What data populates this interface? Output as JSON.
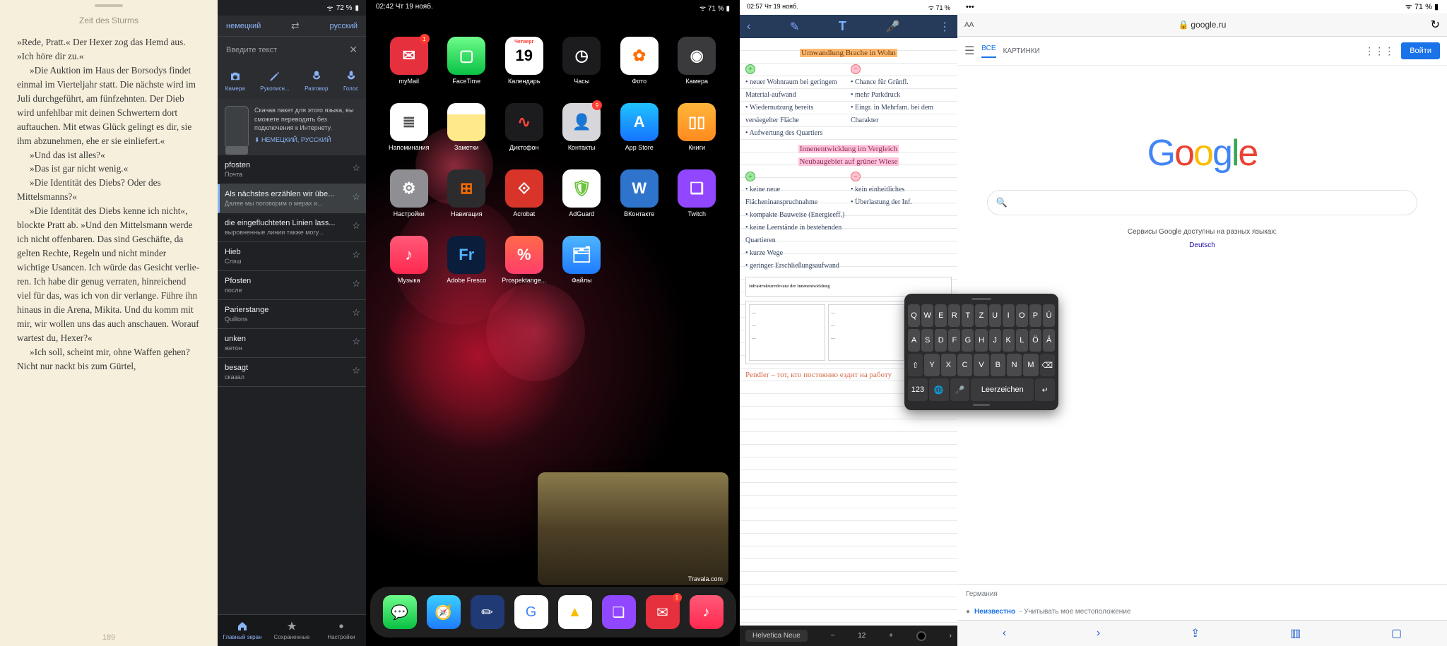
{
  "ereader": {
    "title": "Zeit des Sturms",
    "page": "189",
    "paragraphs": [
      "»Rede, Pratt.« Der Hexer zog das Hemd aus. »Ich höre dir zu.«",
      "»Die Auktion im Haus der Borsodys findet einmal im Vierteljahr statt. Die nächste wird im Juli durchgeführt, am fünfzehnten. Der Dieb wird unfehlbar mit deinen Schwertern dort auftau­chen. Mit etwas Glück gelingt es dir, sie ihm abzunehmen, ehe er sie einlie­fert.«",
      "»Und das ist alles?«",
      "»Das ist gar nicht wenig.«",
      "»Die Identität des Diebs? Oder des Mittelsmanns?«",
      "»Die Identität des Diebs kenne ich nicht«, blockte Pratt ab. »Und den Mit­telsmann werde ich nicht offenbaren. Das sind Geschäfte, da gelten Rechte, Regeln und nicht minder wichtige Usancen. Ich würde das Gesicht verlie­ren. Ich habe dir genug verraten, hin­reichend viel für das, was ich von dir verlange. Führe ihn hinaus in die Are­na, Mikita. Und du komm mit mir, wir wollen uns das auch anschauen. Wor­auf wartest du, Hexer?«",
      "»Ich soll, scheint mir, ohne Waffen gehen? Nicht nur nackt bis zum Gürtel,"
    ]
  },
  "translator": {
    "status_right": "72 %",
    "lang_from": "немецкий",
    "lang_to": "русский",
    "placeholder": "Введите текст",
    "modes": [
      {
        "icon": "camera",
        "label": "Камера"
      },
      {
        "icon": "pen",
        "label": "Рукописн..."
      },
      {
        "icon": "mic2",
        "label": "Разговор"
      },
      {
        "icon": "mic",
        "label": "Голос"
      }
    ],
    "offline_text": "Скачав пакет для этого языка, вы сможете переводить без подключения к Интернету.",
    "offline_langs": "⬇ НЕМЕЦКИЙ, РУССКИЙ",
    "rows": [
      {
        "t": "pfosten",
        "s": "Почта"
      },
      {
        "t": "Als nächstes erzählen wir übe...",
        "s": "Далее мы поговорим о мерах и...",
        "sel": true
      },
      {
        "t": "die eingefluchteten Linien lass...",
        "s": "выровненные линии также могу..."
      },
      {
        "t": "Hieb",
        "s": "Слэш"
      },
      {
        "t": "Pfosten",
        "s": "после"
      },
      {
        "t": "Parierstange",
        "s": "Quillons"
      },
      {
        "t": "unken",
        "s": "жетон"
      },
      {
        "t": "besagt",
        "s": "сказал"
      }
    ],
    "tabs": [
      {
        "label": "Главный экран",
        "icon": "home",
        "active": true
      },
      {
        "label": "Сохраненные",
        "icon": "star"
      },
      {
        "label": "Настройки",
        "icon": "gear"
      }
    ]
  },
  "home": {
    "status_left": "02:42  Чт 19 нояб.",
    "status_right": "71 %",
    "apps": [
      {
        "label": "myMail",
        "bg": "#e6303d",
        "glyph": "✉",
        "badge": "1"
      },
      {
        "label": "FaceTime",
        "bg": "linear-gradient(#6efc8a,#09c143)",
        "glyph": "▢"
      },
      {
        "label": "Календарь",
        "bg": "#fff",
        "glyph": "19",
        "fg": "#000",
        "top": "Четверг"
      },
      {
        "label": "Часы",
        "bg": "#1c1c1e",
        "glyph": "◷"
      },
      {
        "label": "Фото",
        "bg": "#fff",
        "glyph": "✿",
        "fg": "#ff6d00"
      },
      {
        "label": "Камера",
        "bg": "#3a3a3c",
        "glyph": "◉"
      },
      {
        "label": "Напоминания",
        "bg": "#fff",
        "glyph": "≣",
        "fg": "#555"
      },
      {
        "label": "Заметки",
        "bg": "linear-gradient(#fff 30%,#ffe98a 30%)",
        "glyph": "",
        "fg": "#000"
      },
      {
        "label": "Диктофон",
        "bg": "#1c1c1e",
        "glyph": "∿",
        "fg": "#ff453a"
      },
      {
        "label": "Контакты",
        "bg": "#d7d7db",
        "glyph": "👤",
        "badge": "9"
      },
      {
        "label": "App Store",
        "bg": "linear-gradient(#1fc3ff,#1673ff)",
        "glyph": "A"
      },
      {
        "label": "Книги",
        "bg": "linear-gradient(#ffb63a,#ff8a1f)",
        "glyph": "▯▯"
      },
      {
        "label": "Настройки",
        "bg": "#8e8e93",
        "glyph": "⚙"
      },
      {
        "label": "Навигация",
        "bg": "#2c2c2e",
        "glyph": "⊞",
        "fg": "#ff6d00"
      },
      {
        "label": "Acrobat",
        "bg": "#d8342a",
        "glyph": "⟐"
      },
      {
        "label": "AdGuard",
        "bg": "#fff",
        "glyph": "🛡",
        "fg": "#6bc23c"
      },
      {
        "label": "ВКонтакте",
        "bg": "#2e74cc",
        "glyph": "W"
      },
      {
        "label": "Twitch",
        "bg": "#9146ff",
        "glyph": "❏"
      },
      {
        "label": "Музыка",
        "bg": "linear-gradient(#ff5a78,#ff2850)",
        "glyph": "♪"
      },
      {
        "label": "Adobe Fresco",
        "bg": "#0a1d3a",
        "glyph": "Fr",
        "fg": "#4fb3ff"
      },
      {
        "label": "Prospektange...",
        "bg": "linear-gradient(#ff6a4a,#ff3e6a)",
        "glyph": "%"
      },
      {
        "label": "Файлы",
        "bg": "linear-gradient(#4fb6ff,#1f7bff)",
        "glyph": "🗂"
      }
    ],
    "pip_brand": "Travala.com",
    "dock": [
      {
        "bg": "linear-gradient(#6efc8a,#09c143)",
        "glyph": "💬"
      },
      {
        "bg": "linear-gradient(#39d0ff,#1f7bff)",
        "glyph": "🧭"
      },
      {
        "bg": "#1f3a74",
        "glyph": "✏"
      },
      {
        "bg": "#fff",
        "glyph": "G",
        "fg": "#4285f4"
      },
      {
        "bg": "#fff",
        "glyph": "▲",
        "fg": "#fbbc05"
      },
      {
        "bg": "#9146ff",
        "glyph": "❏"
      },
      {
        "bg": "#e6303d",
        "glyph": "✉",
        "badge": "1"
      },
      {
        "bg": "linear-gradient(#ff5a78,#ff2850)",
        "glyph": "♪"
      }
    ]
  },
  "notes": {
    "status_left": "02:57  Чт 19 нояб.",
    "status_right": "71 %",
    "hl1": "Umwandlung Brache in Wohn",
    "hl2": "Innenentwicklung im Vergleich",
    "hl3": "Neubaugebiet auf grüner Wiese",
    "left": [
      "• neuer Wohnraum bei geringem Material-aufwand",
      "• Wiedernutzung bereits versiegelter Fläche",
      "• Aufwertung des Quartiers"
    ],
    "right": [
      "• Chance für Grünfl.",
      "• mehr Parkdruck",
      "• Eingr. in Mehrfam. bei dem Charakter"
    ],
    "left2": [
      "• keine neue Flächeninanspruchnahme",
      "• kompakte Bauweise (Energieeff.)",
      "• keine Leerstände in bestehenden Quartieren",
      "• kurze Wege",
      "• geringer Erschließungsaufwand"
    ],
    "right2": [
      "• kein einheitliches",
      "• Überlastung der Inf."
    ],
    "embed_title": "Infrastrukturrelevanz der Innenentwicklung",
    "pendler": "Pendler – тот, кто постоянно ездит на работу",
    "font": "Helvetica Neue",
    "size": "12"
  },
  "keyboard": {
    "rows": [
      [
        "Q",
        "W",
        "E",
        "R",
        "T",
        "Z",
        "U",
        "I",
        "O",
        "P",
        "Ü"
      ],
      [
        "A",
        "S",
        "D",
        "F",
        "G",
        "H",
        "J",
        "K",
        "L",
        "Ö",
        "Ä"
      ],
      [
        "⇧",
        "Y",
        "X",
        "C",
        "V",
        "B",
        "N",
        "M",
        "⌫"
      ]
    ],
    "bottom": [
      "123",
      "🌐",
      "🎤",
      "Leerzeichen",
      "↵"
    ]
  },
  "google": {
    "status_left": "",
    "status_right": "71 %",
    "aa": "AA",
    "url": "google.ru",
    "menu": [
      "ВСЕ",
      "КАРТИНКИ"
    ],
    "login": "Войти",
    "note": "Сервисы Google доступны на разных языках:",
    "lang": "Deutsch",
    "foot": "Германия",
    "foot2_b": "Неизвестно",
    "foot2_t": " - Учитывать мое местоположение"
  }
}
